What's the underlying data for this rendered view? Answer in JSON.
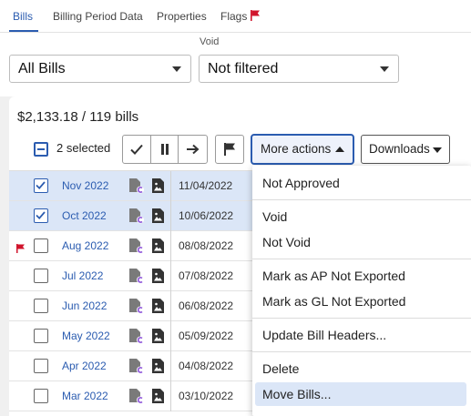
{
  "tabs": [
    {
      "label": "Bills",
      "active": true
    },
    {
      "label": "Billing Period Data",
      "active": false
    },
    {
      "label": "Properties",
      "active": false
    },
    {
      "label": "Flags",
      "active": false,
      "icon": "red-flag-icon"
    }
  ],
  "filters": {
    "bills_select": {
      "value": "All Bills"
    },
    "void_select": {
      "label": "Void",
      "value": "Not filtered"
    }
  },
  "summary": "$2,133.18 / 119 bills",
  "toolbar": {
    "selected_text": "2 selected",
    "action_icons": [
      "approve-check-icon",
      "hold-pause-icon",
      "forward-arrow-icon",
      "flag-icon"
    ],
    "more_actions_label": "More actions",
    "downloads_label": "Downloads"
  },
  "rows": [
    {
      "period": "Nov 2022",
      "date": "11/04/2022",
      "selected": true,
      "flagged": false
    },
    {
      "period": "Oct 2022",
      "date": "10/06/2022",
      "selected": true,
      "flagged": false
    },
    {
      "period": "Aug 2022",
      "date": "08/08/2022",
      "selected": false,
      "flagged": true
    },
    {
      "period": "Jul 2022",
      "date": "07/08/2022",
      "selected": false,
      "flagged": false
    },
    {
      "period": "Jun 2022",
      "date": "06/08/2022",
      "selected": false,
      "flagged": false
    },
    {
      "period": "May 2022",
      "date": "05/09/2022",
      "selected": false,
      "flagged": false
    },
    {
      "period": "Apr 2022",
      "date": "04/08/2022",
      "selected": false,
      "flagged": false
    },
    {
      "period": "Mar 2022",
      "date": "03/10/2022",
      "selected": false,
      "flagged": false
    }
  ],
  "menu": {
    "items": [
      {
        "label": "Not Approved"
      },
      {
        "label": "Void"
      },
      {
        "label": "Not Void"
      },
      {
        "label": "Mark as AP Not Exported"
      },
      {
        "label": "Mark as GL Not Exported"
      },
      {
        "label": "Update Bill Headers..."
      },
      {
        "label": "Delete"
      },
      {
        "label": "Move Bills..."
      }
    ],
    "highlighted": "Move Bills..."
  },
  "colors": {
    "accent": "#2b5cb0",
    "selected_row": "#dbe6f7",
    "flag_red": "#d0142c",
    "doc_icon_gray": "#7a7a7a",
    "doc_icon_purple": "#8a4fd8"
  }
}
